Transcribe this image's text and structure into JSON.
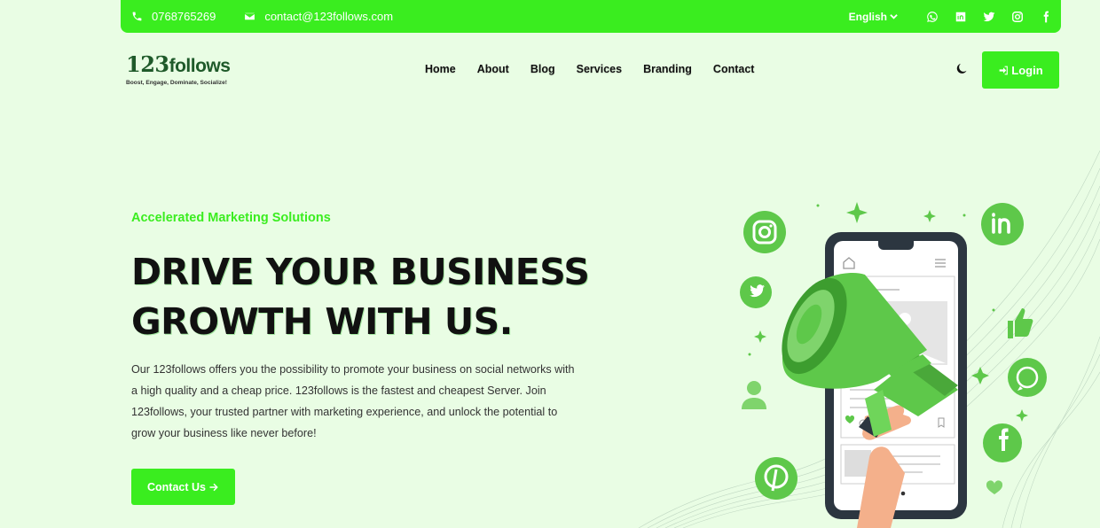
{
  "topbar": {
    "phone": "0768765269",
    "email": "contact@123follows.com",
    "language": "English",
    "social_icons": [
      "whatsapp-icon",
      "linkedin-icon",
      "twitter-icon",
      "instagram-icon",
      "facebook-icon"
    ]
  },
  "brand": {
    "logo_number": "123",
    "logo_word": "follows",
    "tagline": "Boost, Engage, Dominate, Socialize!"
  },
  "nav": {
    "items": [
      "Home",
      "About",
      "Blog",
      "Services",
      "Branding",
      "Contact"
    ],
    "login_label": "Login"
  },
  "hero": {
    "eyebrow": "Accelerated Marketing Solutions",
    "headline_line1": "DRIVE YOUR BUSINESS",
    "headline_line2": "GROWTH WITH US.",
    "description": "Our 123follows offers you the possibility to promote your business on social networks with a high quality and a cheap price. 123follows is the fastest and cheapest Server. Join 123follows, your trusted partner with marketing experience, and unlock the potential to grow your business like never before!",
    "cta_label": "Contact Us"
  },
  "colors": {
    "accent": "#3aed1f",
    "background": "#e9fde4",
    "illustration_green": "#5ec84a",
    "phone_frame": "#2c3640"
  }
}
